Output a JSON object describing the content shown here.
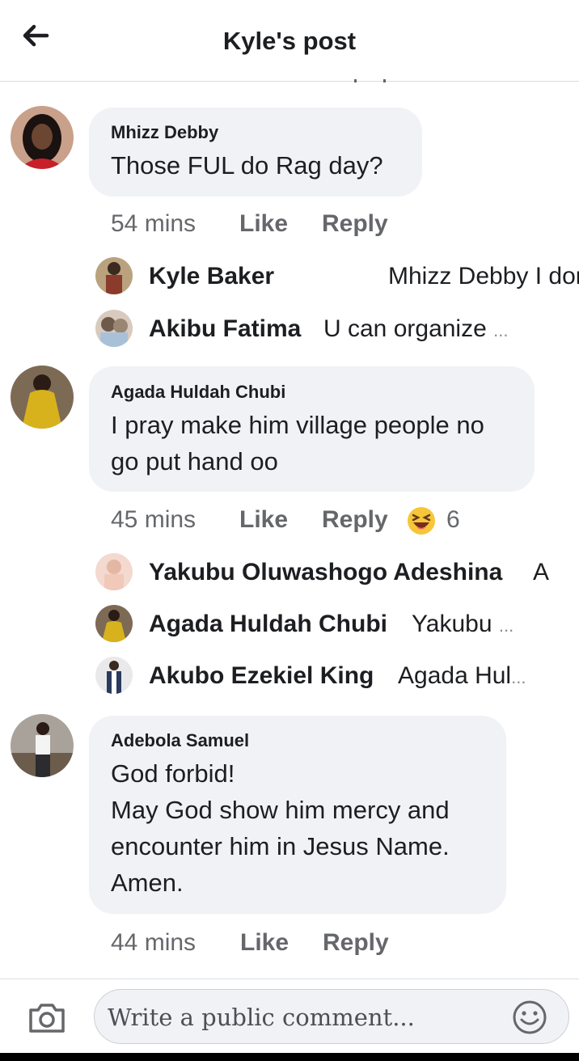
{
  "header": {
    "title": "Kyle's post"
  },
  "comments": [
    {
      "author": "Mhizz Debby",
      "lines": [
        "Those FUL do Rag day?"
      ],
      "time": "54 mins",
      "like": "Like",
      "reply": "Reply",
      "replies": [
        {
          "name": "Kyle Baker",
          "text": "Mhizz Debby I don'",
          "ellipsis": "..."
        },
        {
          "name": "Akibu Fatima",
          "text": "U can organize",
          "ellipsis": "..."
        }
      ]
    },
    {
      "author": "Agada Huldah Chubi",
      "lines": [
        "I pray make him village people no",
        "go put hand oo"
      ],
      "time": "45 mins",
      "like": "Like",
      "reply": "Reply",
      "reaction_count": "6",
      "replies": [
        {
          "name": "Yakubu Oluwashogo Adeshina",
          "text": "A",
          "ellipsis": ""
        },
        {
          "name": "Agada Huldah Chubi",
          "text": "Yakubu",
          "ellipsis": "..."
        },
        {
          "name": "Akubo Ezekiel King",
          "text": "Agada Hul",
          "ellipsis": "..."
        }
      ]
    },
    {
      "author": "Adebola Samuel",
      "lines": [
        "God forbid!",
        "May God show him mercy and",
        "encounter him in Jesus Name.",
        "Amen."
      ],
      "time": "44 mins",
      "like": "Like",
      "reply": "Reply"
    }
  ],
  "composer": {
    "placeholder": "Write a public comment..."
  },
  "icons": {
    "back": "back-arrow-icon",
    "camera": "camera-icon",
    "emoji_picker": "smiley-icon",
    "reaction": "laughing-emoji-icon"
  },
  "colors": {
    "bubble": "#f0f2f5",
    "meta_text": "#65676b",
    "text": "#1c1e21",
    "divider": "#dadde1"
  }
}
